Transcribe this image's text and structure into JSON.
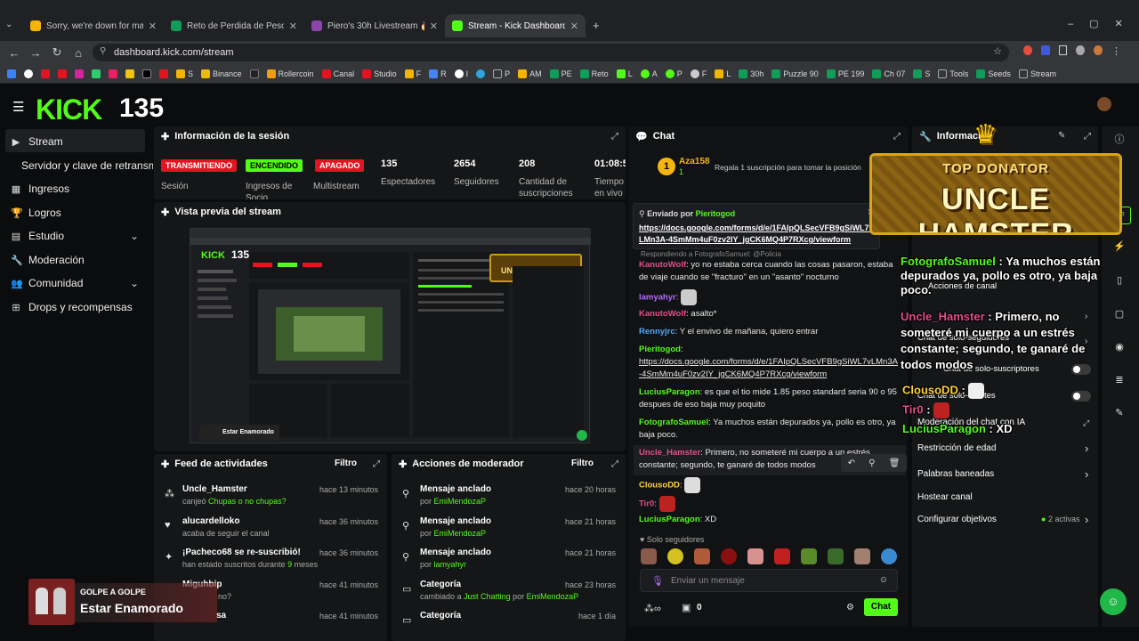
{
  "browser": {
    "tabs": [
      {
        "label": "Sorry, we're down for maintena",
        "color": "#f4b400"
      },
      {
        "label": "Reto de Perdida de Peso - El M",
        "color": "#0f9d58"
      },
      {
        "label": "Piero's 30h Livestream 🎂",
        "color": "#8e44ad"
      },
      {
        "label": "Stream - Kick Dashboard",
        "color": "#53fc18"
      }
    ],
    "url": "dashboard.kick.com/stream",
    "bookmarks": [
      "S",
      "Binance",
      "Rollercoin",
      "Canal",
      "Studio",
      "F",
      "R",
      "I",
      "P",
      "AM",
      "PE",
      "Reto",
      "L",
      "A",
      "P",
      "F",
      "L",
      "30h",
      "Puzzle 90",
      "PE 199",
      "Ch 07",
      "S",
      "Tools",
      "Seeds",
      "Stream"
    ]
  },
  "header": {
    "logo": "KICK",
    "viewer_count": "135"
  },
  "sidebar": {
    "items": [
      {
        "label": "Stream",
        "icon": "video-icon"
      },
      {
        "label": "Servidor y clave de retransmisión",
        "icon": ""
      },
      {
        "label": "Ingresos",
        "icon": "chart-icon"
      },
      {
        "label": "Logros",
        "icon": "trophy-icon"
      },
      {
        "label": "Estudio",
        "icon": "layout-icon"
      },
      {
        "label": "Moderación",
        "icon": "wrench-icon"
      },
      {
        "label": "Comunidad",
        "icon": "people-icon"
      },
      {
        "label": "Drops y recompensas",
        "icon": "gift-icon"
      }
    ]
  },
  "session": {
    "title": "Información de la sesión",
    "badges": [
      {
        "text": "TRANSMITIENDO",
        "label": "Sesión"
      },
      {
        "text": "ENCENDIDO",
        "label": "Ingresos de Socio"
      },
      {
        "text": "APAGADO",
        "label": "Multistream"
      }
    ],
    "stats": [
      {
        "value": "135",
        "label": "Espectadores"
      },
      {
        "value": "2654",
        "label": "Seguidores"
      },
      {
        "value": "208",
        "label": "Cantidad de suscripciones"
      },
      {
        "value": "01:08:5",
        "label": "Tiempo en vivo"
      }
    ]
  },
  "preview": {
    "title": "Vista previa del stream",
    "overlay_brand": "135",
    "caption": "Estar Enamorado"
  },
  "activity": {
    "title": "Feed de actividades",
    "filter": "Filtro",
    "items": [
      {
        "user": "Uncle_Hamster",
        "detail": "canjeó",
        "extra": "Chupas o no chupas?",
        "time": "hace 13 minutos"
      },
      {
        "user": "alucardelloko",
        "detail": "acaba de seguir el canal",
        "extra": "",
        "time": "hace 36 minutos"
      },
      {
        "user": "¡Pacheco68 se re-suscribió!",
        "detail": "han estado suscritos durante",
        "extra": "9",
        "detail2": "meses",
        "time": "hace 36 minutos"
      },
      {
        "user": "Miguhbip",
        "detail": "",
        "extra": "no?",
        "time": "hace 41 minutos"
      },
      {
        "user": "",
        "detail": "",
        "extra": "",
        "tail": "sa",
        "time": "hace 41 minutos"
      }
    ]
  },
  "modactions": {
    "title": "Acciones de moderador",
    "filter": "Filtro",
    "items": [
      {
        "action": "Mensaje anclado",
        "by": "por",
        "user": "EmiMendozaP",
        "time": "hace 20 horas"
      },
      {
        "action": "Mensaje anclado",
        "by": "por",
        "user": "EmiMendozaP",
        "time": "hace 21 horas"
      },
      {
        "action": "Mensaje anclado",
        "by": "por",
        "user": "lamyahyr",
        "time": "hace 21 horas"
      },
      {
        "action": "Categoría",
        "by": "cambiado a",
        "user": "Just Chatting",
        "by2": "por",
        "user2": "EmiMendozaP",
        "time": "hace 23 horas"
      },
      {
        "action": "Categoría",
        "by": "",
        "user": "",
        "time": "hace 1 día"
      }
    ]
  },
  "chat": {
    "title": "Chat",
    "gifter": {
      "rank": "1",
      "name": "Aza158",
      "count": "1",
      "cta": "Regala 1 suscripción para tomar la posición"
    },
    "pinned": {
      "label": "Enviado por",
      "user": "Pieritogod",
      "link": "https://docs.google.com/forms/d/e/1FAIpQLSecVFB9gSiWL7vLMn3A-4SmMm4uF0zv2IY_jgCK6MQ4P7RXcg/viewform"
    },
    "reply_to": "Respondiendo a FotografoSamuel: @Policia",
    "messages": [
      {
        "user": "KanutoWolf",
        "color": "#e64c8c",
        "text": "yo no estaba cerca cuando las cosas pasaron, estaba de viaje cuando se \"fracturo\" en un \"asanto\" nocturno"
      },
      {
        "user": "lamyahyr",
        "color": "#b46cff",
        "text": ""
      },
      {
        "user": "KanutoWolf",
        "color": "#e64c8c",
        "text": "asalto*"
      },
      {
        "user": "Rennyjrc",
        "color": "#4fa9ff",
        "text": "Y el envivo de mañana, quiero entrar"
      },
      {
        "user": "Pieritogod",
        "color": "#53fc18",
        "text": "https://docs.google.com/forms/d/e/1FAIpQLSecVFB9gSiWL7vLMn3A-4SmMm4uF0zv2IY_jgCK6MQ4P7RXcg/viewform"
      },
      {
        "user": "LuciusParagon",
        "color": "#53fc18",
        "text": "es que el tio mide 1.85 peso standard seria 90 o 95 despues de eso baja muy poquito"
      },
      {
        "user": "FotografoSamuel",
        "color": "#53fc18",
        "text": "Ya muchos están depurados ya, pollo es otro, ya baja poco."
      },
      {
        "user": "Uncle_Hamster",
        "color": "#e64c8c",
        "text": "Primero, no someteré mi cuerpo a un estrés constante; segundo, te ganaré de todos modos"
      },
      {
        "user": "ClousoDD",
        "color": "#ffd23f",
        "text": ""
      },
      {
        "user": "Tir0",
        "color": "#e64c8c",
        "text": ""
      },
      {
        "user": "LuciusParagon",
        "color": "#53fc18",
        "text": "XD"
      }
    ],
    "followers_only": "Solo seguidores",
    "input_placeholder": "Enviar un mensaje",
    "points": "0",
    "send": "Chat"
  },
  "info_panel": {
    "title": "Información",
    "items": [
      {
        "label": "Acciones de canal"
      },
      {
        "label": "Chat de solo-seguidores"
      },
      {
        "label": "Chat de solo-suscriptores"
      },
      {
        "label": "Chat de solo-emotes"
      },
      {
        "label": "Moderación del chat con IA"
      },
      {
        "label": "Restricción de edad"
      },
      {
        "label": "Palabras baneadas"
      },
      {
        "label": "Hostear canal"
      },
      {
        "label": "Configurar objetivos",
        "status": "2 activas"
      }
    ]
  },
  "overlay": {
    "donator_top": "TOP DONATOR",
    "donator_name": "UNCLE HAMSTER",
    "chat": [
      {
        "user": "FotografoSamuel",
        "text": "Ya muchos están depurados ya, pollo es otro, ya baja poco."
      },
      {
        "user": "Uncle_Hamster",
        "text": "Primero, no someteré mi cuerpo a un estrés constante; segundo, te ganaré de todos modos"
      },
      {
        "user": "ClousoDD",
        "text": ""
      },
      {
        "user": "Tir0",
        "text": ""
      },
      {
        "user": "LuciusParagon",
        "text": "XD"
      }
    ],
    "song_artist": "GOLPE A GOLPE",
    "song_title": "Estar Enamorado"
  },
  "colors": {
    "accent": "#53fc18",
    "live": "#e3141f",
    "panel": "#151617"
  }
}
